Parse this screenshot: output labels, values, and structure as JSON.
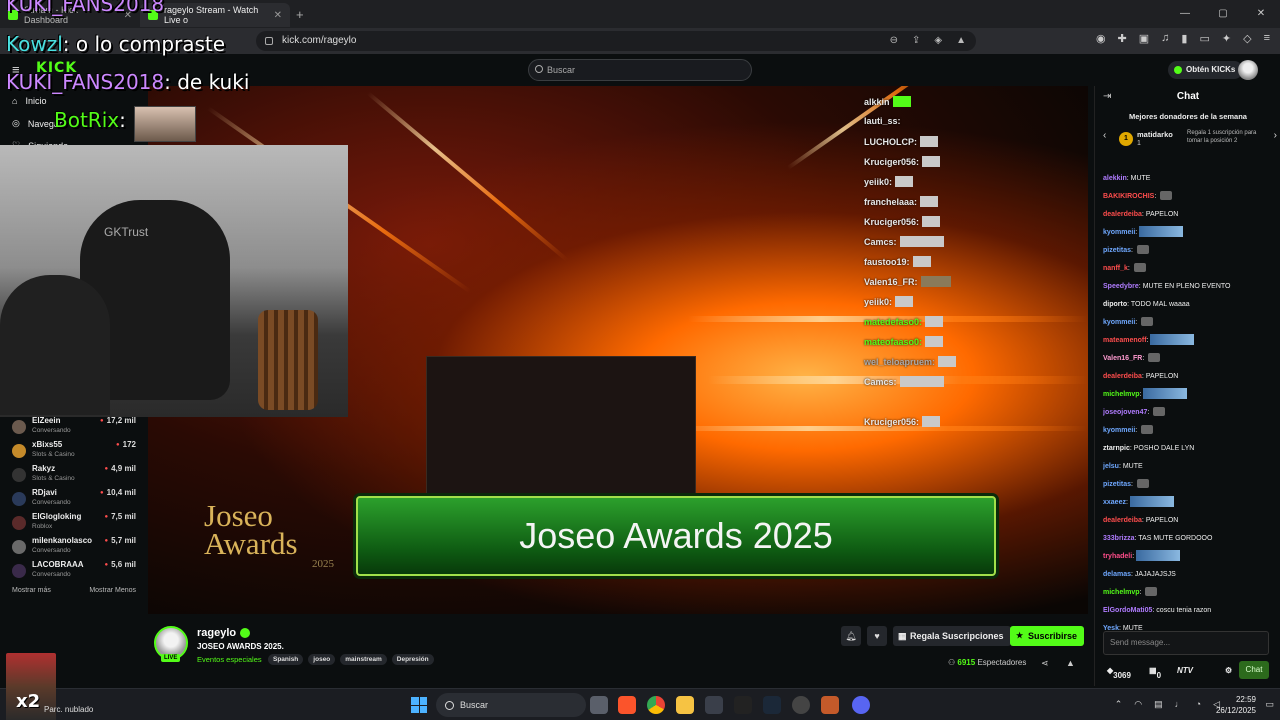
{
  "browser": {
    "tabs": [
      {
        "label": "Stream - Kick Dashboard"
      },
      {
        "label": "rageylo Stream - Watch Live o"
      }
    ],
    "url": "kick.com/rageylo",
    "window_controls": [
      "—",
      "▢",
      "✕"
    ]
  },
  "header": {
    "logo": "KICK",
    "search_placeholder": "Buscar",
    "get_kicks": "Obtén KICKs"
  },
  "sidebar": {
    "nav": [
      {
        "label": "Inicio"
      },
      {
        "label": "Navegar"
      },
      {
        "label": "Siguiendo"
      }
    ],
    "channels": [
      {
        "name": "ElZeein",
        "category": "Conversando",
        "viewers": "17,2 mil"
      },
      {
        "name": "xBixs55",
        "category": "Slots & Casino",
        "viewers": "172"
      },
      {
        "name": "Rakyz",
        "category": "Slots & Casino",
        "viewers": "4,9 mil"
      },
      {
        "name": "RDjavi",
        "category": "Conversando",
        "viewers": "10,4 mil"
      },
      {
        "name": "ElGlogloking",
        "category": "Roblox",
        "viewers": "7,5 mil"
      },
      {
        "name": "milenkanolasco",
        "category": "Conversando",
        "viewers": "5,7 mil"
      },
      {
        "name": "LACOBRAAA",
        "category": "Conversando",
        "viewers": "5,6 mil"
      }
    ],
    "show_more": "Mostrar más",
    "show_less": "Mostrar Menos"
  },
  "overlay": {
    "lines": [
      {
        "user": "KUKI_FANS2018",
        "text": ""
      },
      {
        "user": "Kowzl",
        "text": ": o lo compraste"
      },
      {
        "user": "KUKI_FANS2018",
        "text": ": de kuki"
      },
      {
        "user": "BotRix",
        "text": ":"
      }
    ],
    "cam_label": "GKTrust"
  },
  "video": {
    "banner": "Joseo Awards 2025",
    "logo_line1": "Joseo",
    "logo_line2": "Awards",
    "logo_year": "2025",
    "stream_chat": [
      "alkkin",
      "lauti_ss:",
      "LUCHOLCP:",
      "Kruciger056:",
      "yeiik0:",
      "franchelaaa:",
      "Kruciger056:",
      "Camcs:",
      "faustoo19:",
      "Valen16_FR:",
      "yeiik0:",
      "matedefaso0:",
      "mateofaaso0:",
      "wel_teloapruem:",
      "Camcs:",
      "Kruciger056:"
    ]
  },
  "channel": {
    "name": "rageylo",
    "live_label": "LIVE",
    "title": "JOSEO AWARDS 2025.",
    "category": "Eventos especiales",
    "tags": [
      "Spanish",
      "joseo",
      "mainstream",
      "Depresión"
    ],
    "gift_label": "Regala Suscripciones",
    "subscribe_label": "Suscribirse",
    "viewers_count": "6915",
    "viewers_label": "Espectadores"
  },
  "chat": {
    "title": "Chat",
    "donors_title": "Mejores donadores de la semana",
    "donor": {
      "rank": "1",
      "name": "matidarko",
      "count": "1",
      "cta": "Regala 1 suscripción para tomar la posición 2"
    },
    "messages": [
      {
        "user": "alekkin",
        "text": "MUTE",
        "color": "#b07cff"
      },
      {
        "user": "BAKIKIROCHIS",
        "text": "",
        "color": "#ff4d4d"
      },
      {
        "user": "dealerdeiba",
        "text": "PAPELON",
        "color": "#ff4d4d"
      },
      {
        "user": "kyommeii",
        "text": "",
        "color": "#6fa8ff"
      },
      {
        "user": "pizetitas",
        "text": "",
        "color": "#6fa8ff"
      },
      {
        "user": "nanff_k",
        "text": "",
        "color": "#ff4d4d"
      },
      {
        "user": "Speedybre",
        "text": "MUTE EN PLENO EVENTO",
        "color": "#b07cff"
      },
      {
        "user": "diporto",
        "text": "TODO MAL waaaa",
        "color": "#eeeeee"
      },
      {
        "user": "kyommeii",
        "text": "",
        "color": "#6fa8ff"
      },
      {
        "user": "mateamenoff",
        "text": "",
        "color": "#ff4d4d"
      },
      {
        "user": "Valen16_FR",
        "text": "",
        "color": "#ff9bd0"
      },
      {
        "user": "dealerdeiba",
        "text": "PAPELON",
        "color": "#ff4d4d"
      },
      {
        "user": "michelmvp",
        "text": "",
        "color": "#53fc18"
      },
      {
        "user": "joseojoven47",
        "text": "",
        "color": "#b07cff"
      },
      {
        "user": "kyommeii",
        "text": "",
        "color": "#6fa8ff"
      },
      {
        "user": "ztarnpic",
        "text": "POSHO DALE LYN",
        "color": "#eeeeee"
      },
      {
        "user": "jelsu",
        "text": "MUTE",
        "color": "#6fa8ff"
      },
      {
        "user": "pizetitas",
        "text": "",
        "color": "#6fa8ff"
      },
      {
        "user": "xxaeez",
        "text": "",
        "color": "#6fa8ff"
      },
      {
        "user": "dealerdeiba",
        "text": "PAPELON",
        "color": "#ff4d4d"
      },
      {
        "user": "333brizza",
        "text": "TAS MUTE GORDOOO",
        "color": "#b07cff"
      },
      {
        "user": "tryhadeli",
        "text": "",
        "color": "#ff4d8a"
      },
      {
        "user": "delamas",
        "text": "JAJAJAJSJS",
        "color": "#6fa8ff"
      },
      {
        "user": "michelmvp",
        "text": "",
        "color": "#53fc18"
      },
      {
        "user": "ElGordoMati05",
        "text": "coscu tenia razon",
        "color": "#b07cff"
      },
      {
        "user": "Yesk",
        "text": "MUTE",
        "color": "#6fa8ff"
      }
    ],
    "input_placeholder": "Send message...",
    "kicks_count": "3069",
    "gifts_count": "0",
    "ntv_label": "NTV",
    "send_label": "Chat"
  },
  "taskbar": {
    "weather": "Parc. nublado",
    "search": "Buscar",
    "time": "22:59",
    "date": "26/12/2025"
  }
}
